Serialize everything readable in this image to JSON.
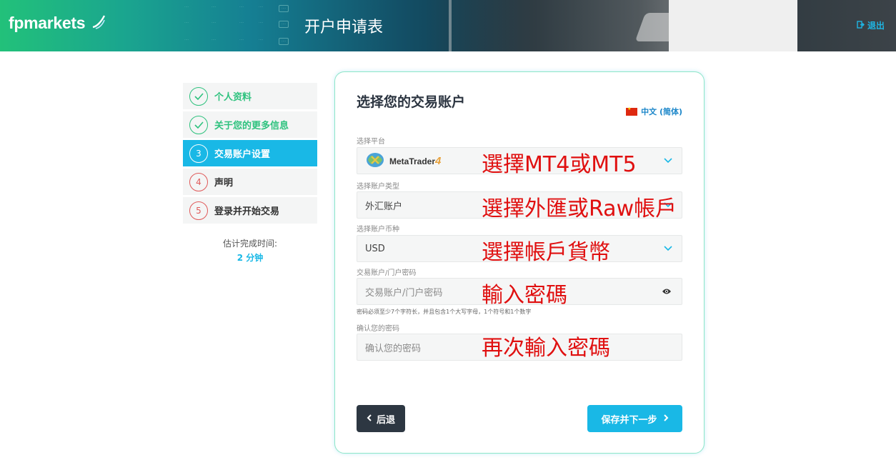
{
  "header": {
    "brand": "fpmarkets",
    "title": "开户申请表",
    "logout_label": "退出"
  },
  "steps": [
    {
      "number": "1",
      "label": "个人资料",
      "state": "done"
    },
    {
      "number": "2",
      "label": "关于您的更多信息",
      "state": "done"
    },
    {
      "number": "3",
      "label": "交易账户设置",
      "state": "active"
    },
    {
      "number": "4",
      "label": "声明",
      "state": "todo"
    },
    {
      "number": "5",
      "label": "登录并开始交易",
      "state": "todo"
    }
  ],
  "eta": {
    "label": "估计完成时间:",
    "value": "2 分钟"
  },
  "form": {
    "title": "选择您的交易账户",
    "language": "中文 (简体)",
    "platform": {
      "label": "选择平台",
      "value": "MetaTrader",
      "value_suffix": "4"
    },
    "account_type": {
      "label": "选择账户类型",
      "value": "外汇账户"
    },
    "currency": {
      "label": "选择账户币种",
      "value": "USD"
    },
    "password": {
      "label": "交易账户/门户密码",
      "placeholder": "交易账户/门户密码"
    },
    "password_hint": "密码必须至少7个字符长，并且包含1个大写字母，1个符号和1个数字",
    "confirm_password": {
      "label": "确认您的密码",
      "placeholder": "确认您的密码"
    },
    "back_label": "后退",
    "next_label": "保存并下一步"
  },
  "annotations": {
    "platform": "選擇MT4或MT5",
    "account_type": "選擇外匯或Raw帳戶",
    "currency": "選擇帳戶貨幣",
    "password": "輸入密碼",
    "confirm_password": "再次輸入密碼"
  },
  "colors": {
    "accent": "#19b8e6",
    "done": "#2ec27e",
    "todo": "#e05a5a",
    "annotation": "#e01010",
    "dark_button": "#2d3742"
  },
  "icons": [
    "check-icon",
    "chevron-down-icon",
    "eye-icon",
    "chevron-left-icon",
    "chevron-right-icon",
    "china-flag-icon",
    "logout-icon",
    "metatrader-logo-icon"
  ]
}
